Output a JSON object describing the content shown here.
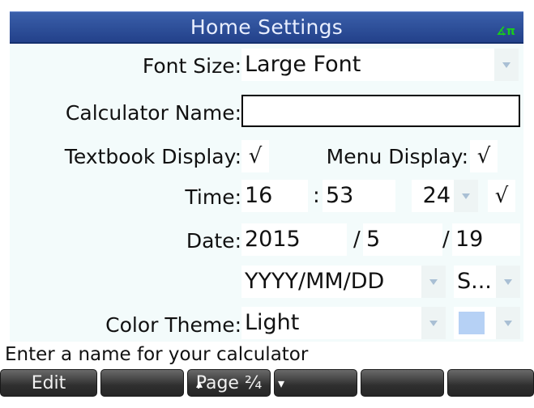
{
  "header": {
    "title": "Home Settings",
    "angle_indicator": "∡π"
  },
  "settings": {
    "font_size": {
      "label": "Font Size:",
      "value": "Large Font"
    },
    "calculator_name": {
      "label": "Calculator Name:",
      "value": ""
    },
    "textbook_display": {
      "label": "Textbook Display:",
      "checked": "√"
    },
    "menu_display": {
      "label": "Menu Display:",
      "checked": "√"
    },
    "time": {
      "label": "Time:",
      "hour": "16",
      "separator": ":",
      "minute": "53",
      "format": "24",
      "checked": "√"
    },
    "date": {
      "label": "Date:",
      "year": "2015",
      "separator1": "/",
      "month": "5",
      "separator2": "/",
      "day": "19",
      "format": "YYYY/MM/DD",
      "second_format": "S..."
    },
    "color_theme": {
      "label": "Color Theme:",
      "value": "Light",
      "swatch_color": "#b6d1f5"
    }
  },
  "help_text": "Enter a name for your calculator",
  "softkeys": {
    "edit": "Edit",
    "page": "Page ²⁄₄",
    "page_up_mark": "▴",
    "page_down_mark": "▾"
  },
  "colors": {
    "title_bar": "#23418a",
    "settings_background": "#f3fbfb",
    "softkey": "#2f2f2f"
  }
}
